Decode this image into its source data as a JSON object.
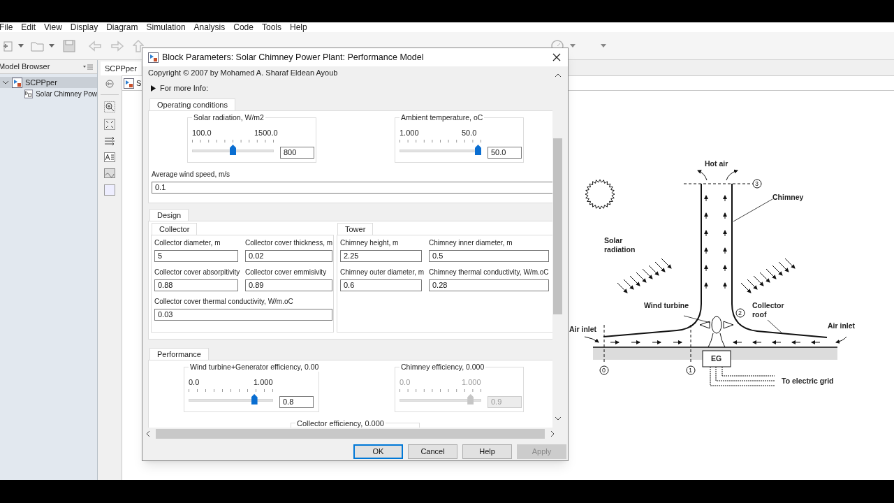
{
  "menu": [
    "File",
    "Edit",
    "View",
    "Display",
    "Diagram",
    "Simulation",
    "Analysis",
    "Code",
    "Tools",
    "Help"
  ],
  "model_browser": {
    "title": "Model Browser",
    "tree": [
      {
        "label": "SCPPper",
        "expanded": true,
        "selected": true,
        "children": [
          {
            "label": "Solar Chimney Pow",
            "selected": false
          }
        ]
      }
    ]
  },
  "editor_tabs": [
    {
      "label": "SCPPper",
      "selected": true
    }
  ],
  "breadcrumb": "S",
  "dialog": {
    "title": "Block Parameters: Solar Chimney Power Plant: Performance Model",
    "copyright": "Copyright © 2007 by Mohamed A. Sharaf Eldean Ayoub",
    "more_info": {
      "label": "For more Info:",
      "expanded": false
    },
    "operating_conditions": {
      "title": "Operating conditions",
      "sliders": [
        {
          "label": "Solar radiation, W/m2",
          "min": "100.0",
          "max": "1500.0",
          "level": 0.5,
          "value": "800",
          "disabled": false
        },
        {
          "label": "Ambient temperature, oC",
          "min": "1.000",
          "max": "50.0",
          "level": 1,
          "value": "50.0",
          "disabled": false
        }
      ],
      "wind_speed": {
        "label": "Average wind speed, m/s",
        "value": "0.1"
      }
    },
    "design": {
      "title": "Design",
      "tabs": [
        {
          "title": "Collector",
          "fields": [
            {
              "kind": "normal",
              "label": "Collector diameter, m",
              "value": "5"
            },
            {
              "kind": "normal",
              "label": "Collector cover thickness, m",
              "value": "0.02"
            },
            {
              "kind": "normal",
              "label": "Collector cover absorpitivity",
              "value": "0.88"
            },
            {
              "kind": "normal",
              "label": "Collector cover emmisivity",
              "value": "0.89"
            },
            {
              "kind": "wide",
              "label": "Collector cover thermal conductivity, W/m.oC",
              "value": "0.03"
            }
          ]
        },
        {
          "title": "Tower",
          "fields": [
            {
              "kind": "normal",
              "label": "Chimney height, m",
              "value": "2.25"
            },
            {
              "kind": "normal",
              "label": "Chimney inner diameter, m",
              "value": "0.5"
            },
            {
              "kind": "normal",
              "label": "Chimney outer diameter, m",
              "value": "0.6"
            },
            {
              "kind": "normal",
              "label": "Chimney thermal conductivity, W/m.oC",
              "value": "0.28"
            }
          ]
        }
      ]
    },
    "performance": {
      "title": "Performance",
      "sliders": [
        {
          "label": "Wind turbine+Generator efficiency, 0.00",
          "min": "0.0",
          "max": "1.000",
          "level": 0.8,
          "value": "0.8",
          "disabled": false
        },
        {
          "label": "Chimney efficiency, 0.000",
          "min": "0.0",
          "max": "1.000",
          "level": 0.9,
          "value": "0.9",
          "disabled": true
        }
      ],
      "collector_efficiency": "Collector efficiency, 0.000"
    },
    "buttons": [
      {
        "label": "OK",
        "default": true,
        "disabled": false
      },
      {
        "label": "Cancel",
        "default": false,
        "disabled": false
      },
      {
        "label": "Help",
        "default": false,
        "disabled": false
      },
      {
        "label": "Apply",
        "default": false,
        "disabled": true
      }
    ]
  },
  "diagram_labels": [
    "Hot air",
    "Chimney",
    "Solar radiation",
    "Wind turbine",
    "Collector roof",
    "Air inlet",
    "Air inlet",
    "To electric grid",
    "EG",
    "0",
    "1",
    "2",
    "3"
  ]
}
